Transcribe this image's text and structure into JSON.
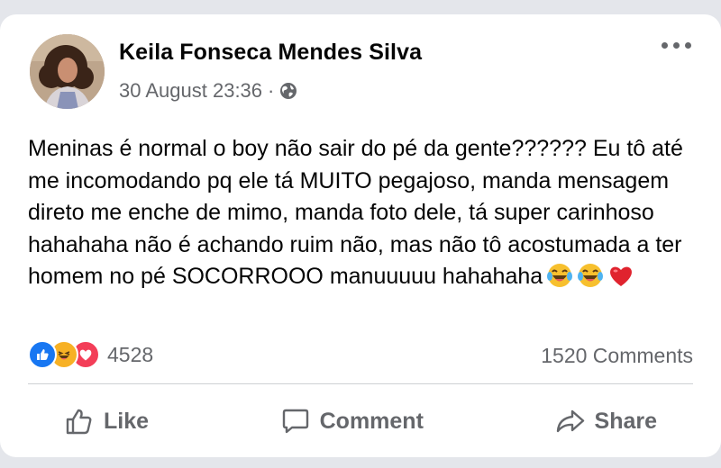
{
  "post": {
    "author": "Keila Fonseca Mendes Silva",
    "timestamp": "30 August 23:36",
    "separator": "·",
    "privacy_icon": "globe-icon",
    "more_icon": "more-options-icon",
    "text": "Meninas é normal o boy não sair do pé da gente?????? Eu tô até me incomodando pq ele tá MUITO pegajoso, manda mensagem direto me enche de mimo, manda foto dele, tá super carinhoso hahahaha não é achando ruim não, mas não tô acostumada a ter homem no pé SOCORROOO manuuuuu hahahaha",
    "emojis": [
      "laughing-tears-emoji",
      "laughing-tears-emoji",
      "red-heart-emoji"
    ]
  },
  "stats": {
    "reaction_icons": [
      "like-reaction-icon",
      "haha-reaction-icon",
      "love-reaction-icon"
    ],
    "reaction_count": "4528",
    "comments": "1520 Comments"
  },
  "actions": {
    "like": "Like",
    "comment": "Comment",
    "share": "Share"
  },
  "colors": {
    "background": "#e4e6eb",
    "card": "#ffffff",
    "text": "#050505",
    "secondary_text": "#65676b",
    "like_blue": "#1877f2",
    "haha_yellow": "#f7b125",
    "love_red": "#f33e58"
  }
}
